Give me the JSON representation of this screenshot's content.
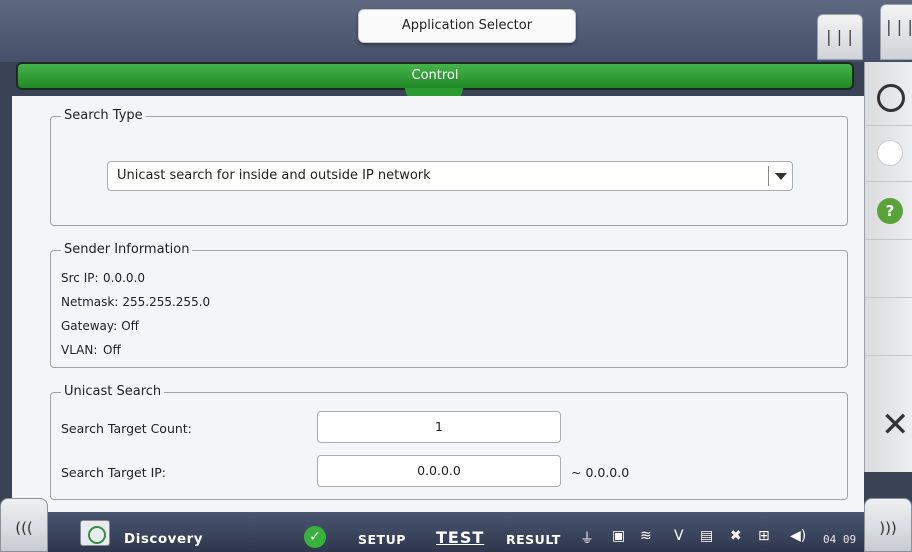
{
  "header": {
    "app_selector_label": "Application Selector",
    "control_label": "Control"
  },
  "search_type": {
    "legend": "Search Type",
    "selected": "Unicast search for inside and outside IP network"
  },
  "sender_info": {
    "legend": "Sender Information",
    "rows": [
      {
        "key": "Src IP:",
        "value": "0.0.0.0"
      },
      {
        "key": "Netmask:",
        "value": "255.255.255.0"
      },
      {
        "key": "Gateway:",
        "value": "Off"
      },
      {
        "key": "VLAN:",
        "value": "Off"
      }
    ]
  },
  "unicast_search": {
    "legend": "Unicast Search",
    "count_label": "Search Target Count:",
    "count_value": "1",
    "ip_label": "Search Target IP:",
    "ip_value": "0.0.0.0",
    "ip_end": "~ 0.0.0.0"
  },
  "side_panel": {
    "icons": [
      "search-icon",
      "status-dot-icon",
      "help-icon",
      "close-icon"
    ],
    "help_glyph": "?"
  },
  "taskbar": {
    "left_nav": "(((",
    "right_nav": ")))",
    "app_name": "Discovery",
    "steps": [
      "SETUP",
      "TEST",
      "RESULT"
    ],
    "active_step": "TEST",
    "clock": "04 09",
    "tray_v": "V"
  }
}
